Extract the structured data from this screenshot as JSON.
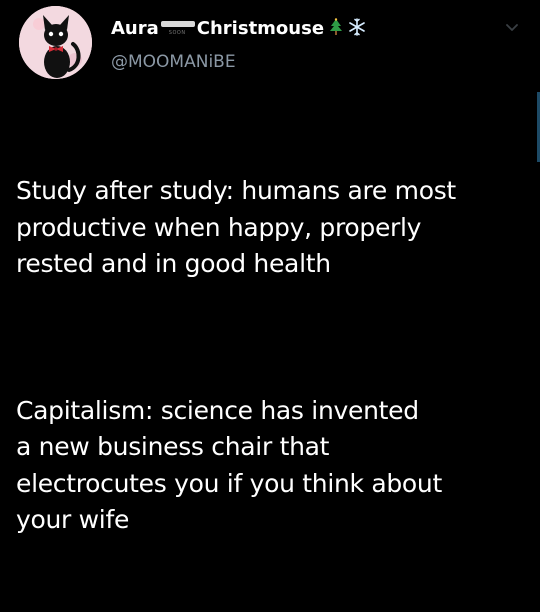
{
  "author": {
    "display_name_first": "Aura",
    "display_name_second": "Christmouse",
    "badge_text": "SOON",
    "handle": "@MOOMANiBE",
    "name_icons": [
      "christmas-tree-icon",
      "snowflake-icon"
    ]
  },
  "tweet": {
    "paragraphs": [
      "Study after study: humans are most\nproductive when happy, properly\nrested and in good health",
      "Capitalism: science has invented\na new business chair that\nelectrocutes you if you think about\nyour wife"
    ]
  },
  "colors": {
    "background": "#000000",
    "text": "#ffffff",
    "handle": "#8b98a5",
    "avatar_bg": "#f3d9e0"
  }
}
